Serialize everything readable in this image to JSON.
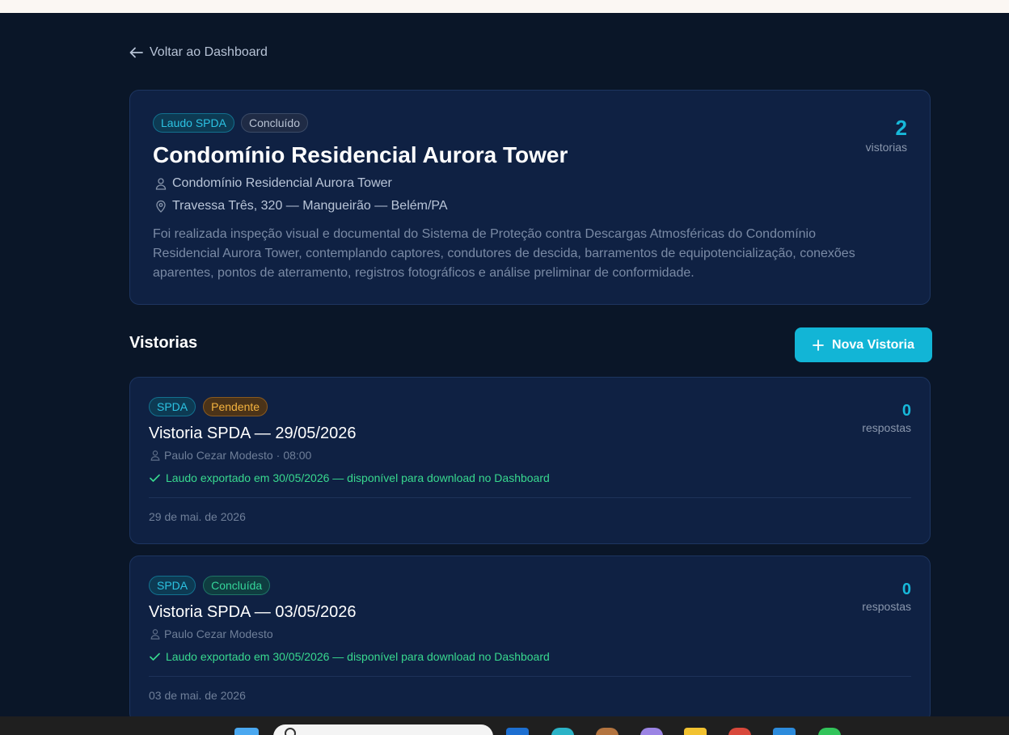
{
  "back_link": {
    "label": "Voltar ao Dashboard"
  },
  "report": {
    "badges": [
      "Laudo SPDA",
      "Concluído"
    ],
    "title": "Condomínio Residencial Aurora Tower",
    "client": "Condomínio Residencial Aurora Tower",
    "address": "Travessa Três, 320 — Mangueirão — Belém/PA",
    "description": "Foi realizada inspeção visual e documental do Sistema de Proteção contra Descargas Atmosféricas do Condomínio Residencial Aurora Tower, contemplando captores, condutores de descida, barramentos de equipotencialização, conexões aparentes, pontos de aterramento, registros fotográficos e análise preliminar de conformidade.",
    "inspection_count": "2",
    "inspection_count_label": "vistorias"
  },
  "inspections_section": {
    "title": "Vistorias",
    "new_button_label": "Nova Vistoria"
  },
  "inspections": [
    {
      "type_badge": "SPDA",
      "status_badge": "Pendente",
      "status_color": "#f4b33f",
      "title": "Vistoria SPDA — 29/05/2026",
      "inspector": "Paulo Cezar Modesto",
      "time": "08:00",
      "export_note": "Laudo exportado em 30/05/2026 — disponível para download no Dashboard",
      "date": "29 de mai. de 2026",
      "responses_count": "0",
      "responses_label": "respostas"
    },
    {
      "type_badge": "SPDA",
      "status_badge": "Concluída",
      "status_color": "#35d69a",
      "title": "Vistoria SPDA — 03/05/2026",
      "inspector": "Paulo Cezar Modesto",
      "time": "",
      "export_note": "Laudo exportado em 30/05/2026 — disponível para download no Dashboard",
      "date": "03 de mai. de 2026",
      "responses_count": "0",
      "responses_label": "respostas"
    }
  ],
  "colors": {
    "background": "#0a1628",
    "card": "#0f2143",
    "accent": "#12b5d6",
    "pending": "#f4b33f",
    "done": "#35d69a"
  },
  "taskbar_icons": [
    "windows-start-icon",
    "outlook-icon",
    "edge-icon",
    "app-icon",
    "copilot-icon",
    "file-explorer-icon",
    "chrome-icon",
    "vscode-icon",
    "whatsapp-icon"
  ]
}
